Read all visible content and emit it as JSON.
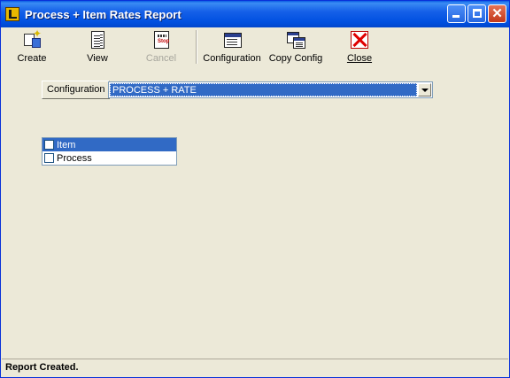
{
  "window": {
    "title": "Process + Item Rates Report"
  },
  "toolbar": {
    "create_label": "Create",
    "view_label": "View",
    "cancel_label": "Cancel",
    "configuration_label": "Configuration",
    "copy_config_label": "Copy Config",
    "close_label": "Close",
    "icons": {
      "create": "create-report-icon",
      "view": "view-report-icon",
      "cancel": "stop-icon",
      "configuration": "configuration-icon",
      "copy_config": "copy-config-icon",
      "close": "close-x-icon"
    }
  },
  "config": {
    "label": "Configuration",
    "selected_value": "PROCESS + RATE"
  },
  "checklist": {
    "items": [
      {
        "label": "Item",
        "checked": false,
        "selected": true
      },
      {
        "label": "Process",
        "checked": false,
        "selected": false
      }
    ]
  },
  "status": {
    "text": "Report Created."
  },
  "colors": {
    "titlebar": "#0050e0",
    "selection": "#316ac5",
    "face": "#ece9d8",
    "close_red": "#e00000"
  }
}
